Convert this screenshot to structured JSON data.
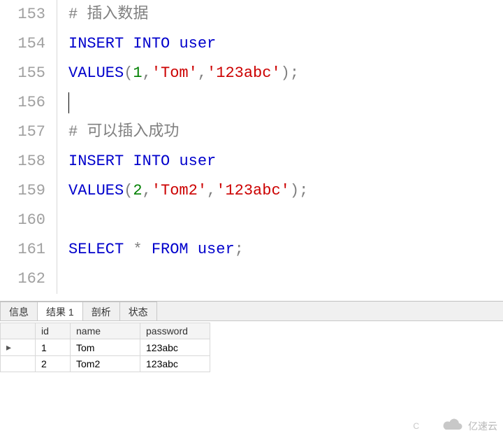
{
  "editor": {
    "lines": [
      {
        "num": "153",
        "tokens": [
          {
            "cls": "c-comment",
            "t": "# 插入数据"
          }
        ]
      },
      {
        "num": "154",
        "tokens": [
          {
            "cls": "c-keyword",
            "t": "INSERT"
          },
          {
            "cls": "",
            "t": " "
          },
          {
            "cls": "c-keyword",
            "t": "INTO"
          },
          {
            "cls": "",
            "t": " "
          },
          {
            "cls": "c-keyword",
            "t": "user"
          }
        ]
      },
      {
        "num": "155",
        "tokens": [
          {
            "cls": "c-keyword",
            "t": "VALUES"
          },
          {
            "cls": "c-punc",
            "t": "("
          },
          {
            "cls": "c-num",
            "t": "1"
          },
          {
            "cls": "c-punc",
            "t": ","
          },
          {
            "cls": "c-str",
            "t": "'Tom'"
          },
          {
            "cls": "c-punc",
            "t": ","
          },
          {
            "cls": "c-str",
            "t": "'123abc'"
          },
          {
            "cls": "c-punc",
            "t": ")"
          },
          {
            "cls": "c-punc",
            "t": ";"
          }
        ]
      },
      {
        "num": "156",
        "tokens": [],
        "cursor": true
      },
      {
        "num": "157",
        "tokens": [
          {
            "cls": "c-comment",
            "t": "# 可以插入成功"
          }
        ]
      },
      {
        "num": "158",
        "tokens": [
          {
            "cls": "c-keyword",
            "t": "INSERT"
          },
          {
            "cls": "",
            "t": " "
          },
          {
            "cls": "c-keyword",
            "t": "INTO"
          },
          {
            "cls": "",
            "t": " "
          },
          {
            "cls": "c-keyword",
            "t": "user"
          }
        ]
      },
      {
        "num": "159",
        "tokens": [
          {
            "cls": "c-keyword",
            "t": "VALUES"
          },
          {
            "cls": "c-punc",
            "t": "("
          },
          {
            "cls": "c-num",
            "t": "2"
          },
          {
            "cls": "c-punc",
            "t": ","
          },
          {
            "cls": "c-str",
            "t": "'Tom2'"
          },
          {
            "cls": "c-punc",
            "t": ","
          },
          {
            "cls": "c-str",
            "t": "'123abc'"
          },
          {
            "cls": "c-punc",
            "t": ")"
          },
          {
            "cls": "c-punc",
            "t": ";"
          }
        ]
      },
      {
        "num": "160",
        "tokens": []
      },
      {
        "num": "161",
        "tokens": [
          {
            "cls": "c-keyword",
            "t": "SELECT"
          },
          {
            "cls": "",
            "t": " "
          },
          {
            "cls": "c-star",
            "t": "*"
          },
          {
            "cls": "",
            "t": " "
          },
          {
            "cls": "c-keyword",
            "t": "FROM"
          },
          {
            "cls": "",
            "t": " "
          },
          {
            "cls": "c-keyword",
            "t": "user"
          },
          {
            "cls": "c-punc",
            "t": ";"
          }
        ]
      },
      {
        "num": "162",
        "tokens": []
      }
    ]
  },
  "tabs": {
    "items": [
      {
        "label": "信息",
        "active": false
      },
      {
        "label": "结果 1",
        "active": true
      },
      {
        "label": "剖析",
        "active": false
      },
      {
        "label": "状态",
        "active": false
      }
    ]
  },
  "result": {
    "columns": [
      "id",
      "name",
      "password"
    ],
    "rows": [
      {
        "handle": "▸",
        "id": "1",
        "name": "Tom",
        "password": "123abc"
      },
      {
        "handle": "",
        "id": "2",
        "name": "Tom2",
        "password": "123abc"
      }
    ]
  },
  "watermark": {
    "text": "亿速云",
    "small": "C"
  }
}
